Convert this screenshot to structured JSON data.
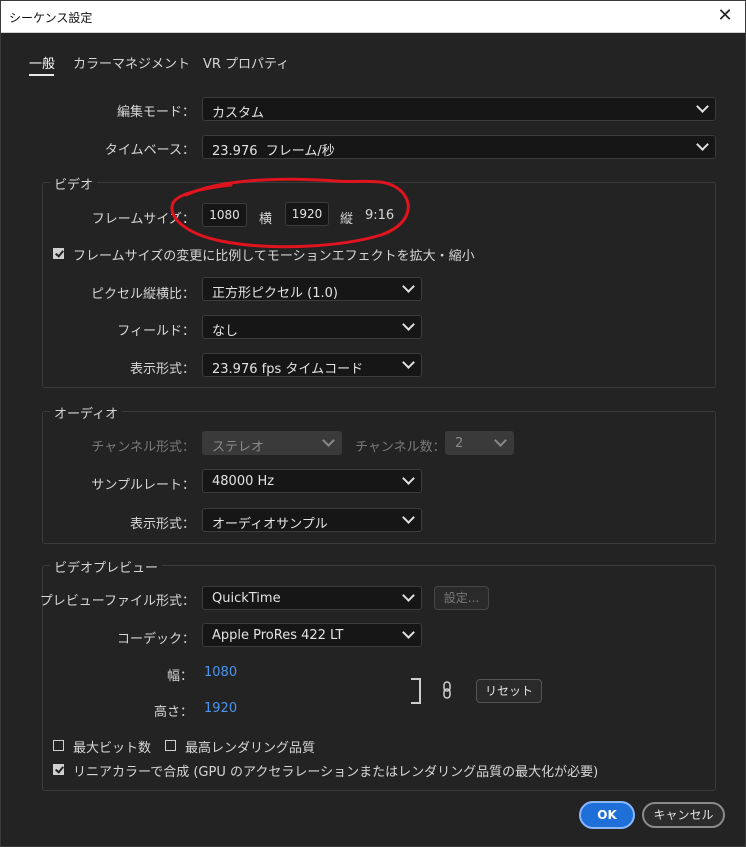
{
  "window": {
    "title": "シーケンス設定",
    "close_glyph": "✕"
  },
  "tabs": [
    {
      "label": "一般",
      "active": true
    },
    {
      "label": "カラーマネジメント",
      "active": false
    },
    {
      "label": "VR プロパティ",
      "active": false
    }
  ],
  "general": {
    "edit_mode_label": "編集モード：",
    "edit_mode_value": "カスタム",
    "timebase_label": "タイムベース：",
    "timebase_value": "23.976  フレーム/秒"
  },
  "video": {
    "group_title": "ビデオ",
    "frame_size_label": "フレームサイズ：",
    "width": "1080",
    "width_unit": "横",
    "height": "1920",
    "height_unit": "縦",
    "aspect": "9:16",
    "scale_checkbox_label": "フレームサイズの変更に比例してモーションエフェクトを拡大・縮小",
    "scale_checked": true,
    "pixel_aspect_label": "ピクセル縦横比：",
    "pixel_aspect_value": "正方形ピクセル (1.0)",
    "fields_label": "フィールド：",
    "fields_value": "なし",
    "display_format_label": "表示形式：",
    "display_format_value": "23.976 fps タイムコード"
  },
  "audio": {
    "group_title": "オーディオ",
    "channel_format_label": "チャンネル形式：",
    "channel_format_value": "ステレオ",
    "channel_count_label": "チャンネル数：",
    "channel_count_value": "2",
    "sample_rate_label": "サンプルレート：",
    "sample_rate_value": "48000 Hz",
    "display_format_label": "表示形式：",
    "display_format_value": "オーディオサンプル"
  },
  "preview": {
    "group_title": "ビデオプレビュー",
    "file_format_label": "プレビューファイル形式：",
    "file_format_value": "QuickTime",
    "settings_button": "設定...",
    "codec_label": "コーデック：",
    "codec_value": "Apple ProRes 422 LT",
    "width_label": "幅：",
    "width_value": "1080",
    "height_label": "高さ：",
    "height_value": "1920",
    "reset_button": "リセット",
    "max_bit_depth_label": "最大ビット数",
    "max_bit_depth_checked": false,
    "max_render_quality_label": "最高レンダリング品質",
    "max_render_quality_checked": false,
    "linear_color_label": "リニアカラーで合成 (GPU のアクセラレーションまたはレンダリング品質の最大化が必要)",
    "linear_color_checked": true
  },
  "footer": {
    "ok_label": "OK",
    "cancel_label": "キャンセル"
  },
  "colors": {
    "accent": "#1f6fd9",
    "link": "#4a96f0",
    "annotation": "#e0141e",
    "background": "#232323"
  }
}
